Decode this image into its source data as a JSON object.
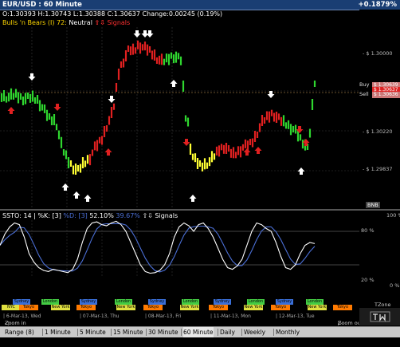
{
  "window": {
    "title": "EUR/USD : 60 Minute",
    "change": "+0.1879%"
  },
  "ohlc": {
    "open": "O:1.30393",
    "high": "H:1.30743",
    "low": "L:1.30388",
    "close": "C:1.30637",
    "change": "Change:0.00245 (0.19%)"
  },
  "indicator": {
    "name": "Bulls 'n Bears (I) 72:",
    "state": "Neutral",
    "signals_label": "Signals"
  },
  "price_axis": {
    "labels": [
      "- $ 1.30000",
      "- $ 1.30220",
      "- $ 1.29837"
    ],
    "buy_label": "Buy",
    "sell_label": "Sell",
    "buy_price": "$ 1.30639",
    "last_price": "$ 1.30637",
    "sell_price": "$ 1.30636",
    "bottom_tag": "BNB"
  },
  "stochastic": {
    "label": "SSTO:",
    "period": "14",
    "k_label": "%K:",
    "k_value": "3",
    "d_label": "%D:",
    "d_value": "3",
    "k_reading": "52.10%",
    "d_reading": "39.67%",
    "signals_label": "Signals",
    "axis_top": "100 %",
    "axis_80": "80 %",
    "axis_20": "20 %",
    "axis_bottom": "0 %",
    "k_color": "#ffffff",
    "d_color": "#4b6fd6"
  },
  "sessions": {
    "top": [
      "Sydney",
      "London",
      "Sydney",
      "London",
      "Sydney",
      "London",
      "Sydney",
      "London",
      "Sydney",
      "London"
    ],
    "bottom": [
      "NYC",
      "Tokyo",
      "New York",
      "Tokyo",
      "New York",
      "Tokyo",
      "New York",
      "Tokyo",
      "New York",
      "Tokyo",
      "New York",
      "Tokyo"
    ],
    "zone_label": "TZone",
    "colors": {
      "sydney": "#3a6fd8",
      "london": "#44cc44",
      "tokyo": "#ff7a00",
      "newyork": "#e0e040",
      "nyc": "#e0e040"
    }
  },
  "dates": [
    "6-Mar-13, Wed",
    "07-Mar-13, Thu",
    "08-Mar-13, Fri",
    "11-Mar-13, Mon",
    "12-Mar-13, Tue"
  ],
  "zoom": {
    "zoom_in": "Zoom in",
    "zoom_out": "Zoom out"
  },
  "toolbar": {
    "items": [
      "Range (8)",
      "1 Minute",
      "5 Minute",
      "15 Minute",
      "30 Minute",
      "60 Minute",
      "Daily",
      "Weekly",
      "Monthly"
    ],
    "selected": "60 Minute"
  },
  "colors": {
    "bull": "#2fd62f",
    "bear": "#e02020",
    "neutral": "#ffff33",
    "titlebar": "#1a3e73",
    "gold_label": "#ffd700",
    "neutral_text": "#ffffff",
    "signal_text": "#ff4040"
  }
}
